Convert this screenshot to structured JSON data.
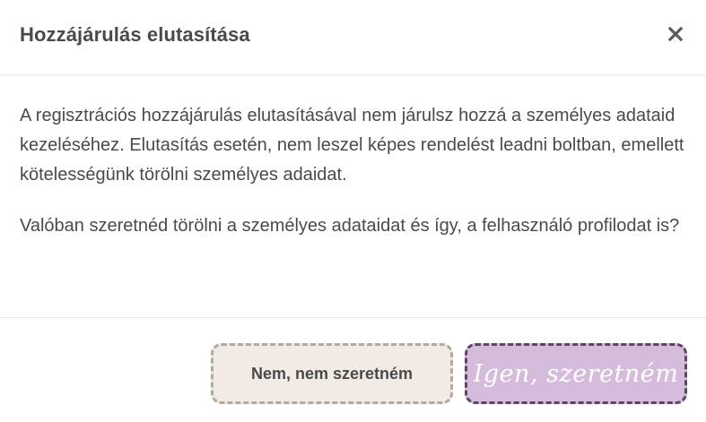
{
  "dialog": {
    "title": "Hozzájárulás elutasítása",
    "close_icon": "close-icon",
    "paragraphs": [
      "A regisztrációs hozzájárulás elutasításával nem járulsz hozzá a személyes adataid kezeléséhez. Elutasítás esetén, nem leszel képes rendelést leadni boltban, emellett kötelességünk törölni személyes adaidat.",
      "Valóban szeretnéd törölni a személyes adataidat és így, a felhasználó profilodat is?"
    ],
    "buttons": {
      "no_label": "Nem, nem szeretném",
      "yes_label": "Igen, szeretném"
    }
  },
  "colors": {
    "text": "#4a4a4a",
    "no_button_bg": "#f2ebe5",
    "no_button_border": "#b5a8a0",
    "yes_button_bg": "#d6bcdc",
    "yes_button_border": "#5b4561",
    "divider": "#e6e6e6"
  }
}
